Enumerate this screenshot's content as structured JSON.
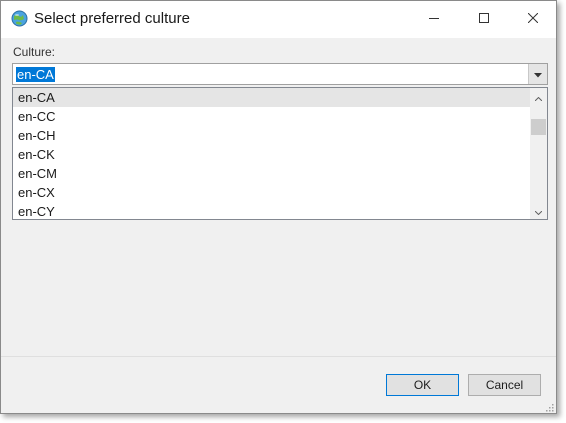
{
  "window": {
    "title": "Select preferred culture",
    "icon": "globe-icon",
    "controls": [
      "minimize-icon",
      "maximize-icon",
      "close-icon"
    ]
  },
  "form": {
    "culture_label": "Culture:",
    "culture_value": "en-CA"
  },
  "dropdown": {
    "items": [
      "en-CA",
      "en-CC",
      "en-CH",
      "en-CK",
      "en-CM",
      "en-CX",
      "en-CY"
    ],
    "highlighted_index": 0
  },
  "buttons": {
    "ok_label": "OK",
    "cancel_label": "Cancel"
  },
  "colors": {
    "selection": "#0078d7",
    "hover": "#e5e5e5",
    "window_bg": "#f0f0f0"
  }
}
